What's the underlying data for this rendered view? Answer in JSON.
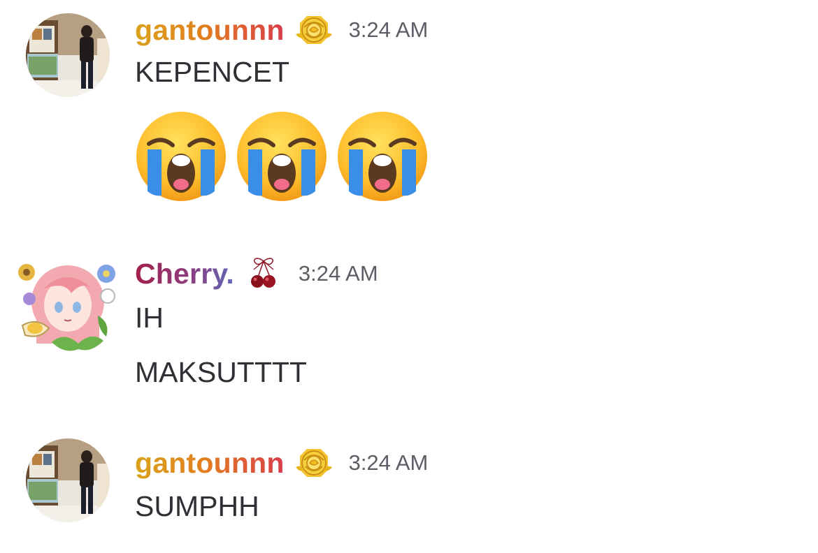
{
  "messages": [
    {
      "username": "gantounnn",
      "timestamp": "3:24 AM",
      "lines": [
        "KEPENCET"
      ],
      "emojis": [
        "loudly-crying-face",
        "loudly-crying-face",
        "loudly-crying-face"
      ]
    },
    {
      "username": "Cherry.",
      "timestamp": "3:24 AM",
      "lines": [
        "IH",
        "MAKSUTTTT"
      ]
    },
    {
      "username": "gantounnn",
      "timestamp": "3:24 AM",
      "lines": [
        "SUMPHH"
      ]
    }
  ],
  "colors": {
    "gantounnn_gradient": [
      "#d9a21a",
      "#e2801f",
      "#d93c4a"
    ],
    "cherry_gradient": [
      "#a3204d",
      "#8c3d7e",
      "#5f68b9"
    ],
    "timestamp": "#5c5e66",
    "message_text": "#2e3035"
  },
  "icons": {
    "gantounnn_role": "yellow-rose-icon",
    "cherry_role": "cherry-with-bow-icon",
    "reaction": "loudly-crying-face-emoji"
  }
}
